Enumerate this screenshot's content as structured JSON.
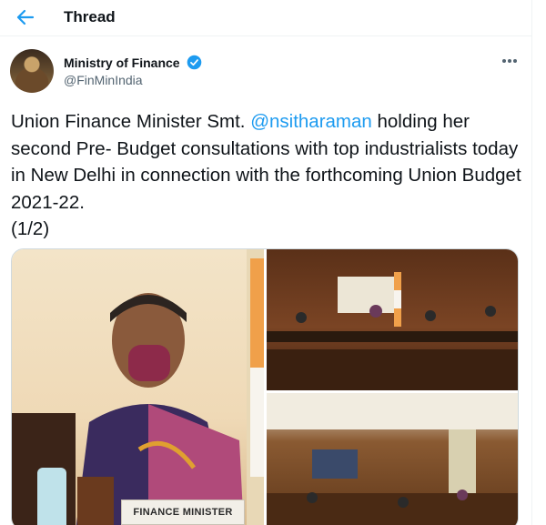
{
  "header": {
    "title": "Thread"
  },
  "tweet": {
    "author_name": "Ministry of Finance",
    "author_handle": "@FinMinIndia",
    "text_before": "Union Finance Minister Smt. ",
    "mention": "@nsitharaman",
    "text_after": " holding her second Pre- Budget consultations with top industrialists today in New Delhi in connection with the forthcoming Union Budget 2021-22.",
    "thread_counter": "(1/2)"
  },
  "media": {
    "name_plate": "FINANCE MINISTER"
  },
  "colors": {
    "accent": "#1d9bf0",
    "text": "#0f1419",
    "muted": "#536471"
  },
  "icons": {
    "back": "arrow-left-icon",
    "verified": "verified-badge-icon",
    "more": "more-dots-icon"
  }
}
